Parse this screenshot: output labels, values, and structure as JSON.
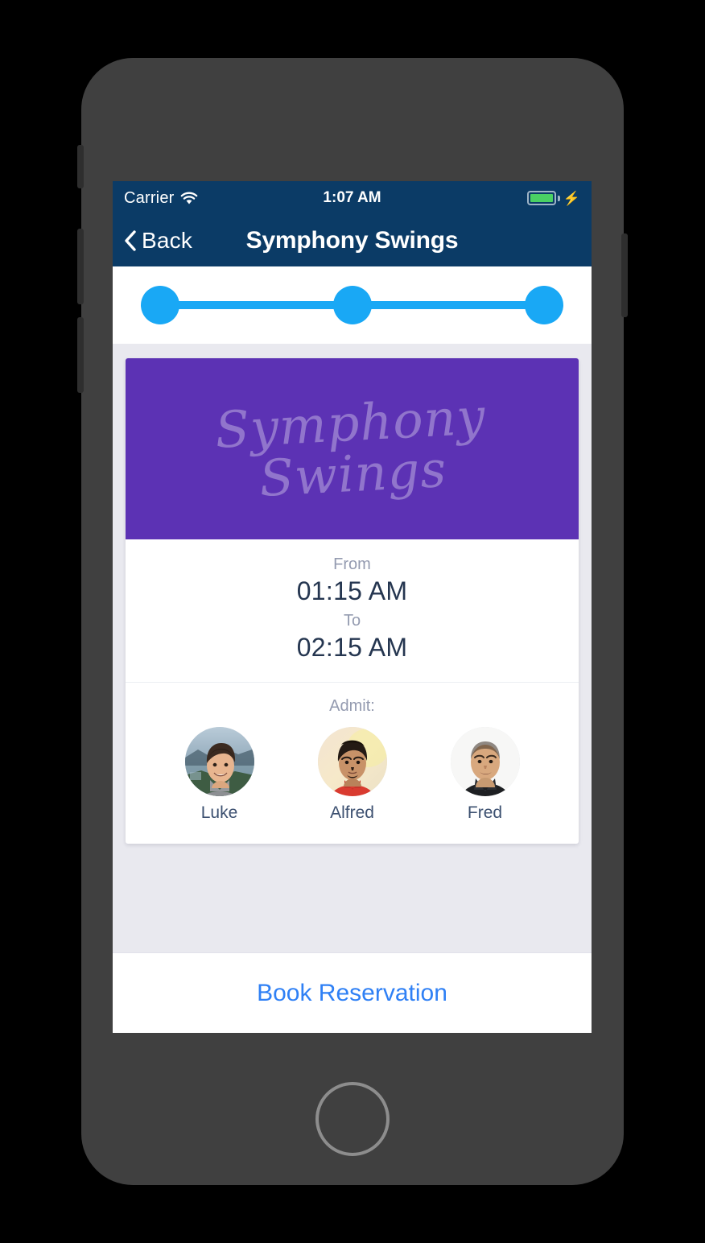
{
  "status_bar": {
    "carrier": "Carrier",
    "wifi_icon": "wifi-icon",
    "time": "1:07 AM",
    "battery_icon": "battery-full-icon",
    "charging_icon": "⚡"
  },
  "nav_bar": {
    "back_icon": "chevron-left-icon",
    "back_label": "Back",
    "title": "Symphony Swings"
  },
  "stepper": {
    "steps": [
      {
        "label": "step-1",
        "state": "complete"
      },
      {
        "label": "step-2",
        "state": "complete"
      },
      {
        "label": "step-3",
        "state": "complete"
      }
    ],
    "active_color": "#19a8f5"
  },
  "event_card": {
    "banner": {
      "logo_line1": "Symphony",
      "logo_line2": "Swings",
      "background_color": "#5c32b4",
      "text_color": "#9b7fd4"
    },
    "schedule": {
      "from_label": "From",
      "from_value": "01:15 AM",
      "to_label": "To",
      "to_value": "02:15 AM"
    },
    "admit": {
      "label": "Admit:",
      "guests": [
        {
          "name": "Luke",
          "avatar": "avatar-luke"
        },
        {
          "name": "Alfred",
          "avatar": "avatar-alfred"
        },
        {
          "name": "Fred",
          "avatar": "avatar-fred"
        }
      ]
    }
  },
  "footer": {
    "book_label": "Book Reservation",
    "book_color": "#2f80f5"
  },
  "device": {
    "home_button": "home-button",
    "power_button": "power-button",
    "volume_up": "volume-up-button",
    "volume_down": "volume-down-button",
    "silent_switch": "silent-switch"
  }
}
